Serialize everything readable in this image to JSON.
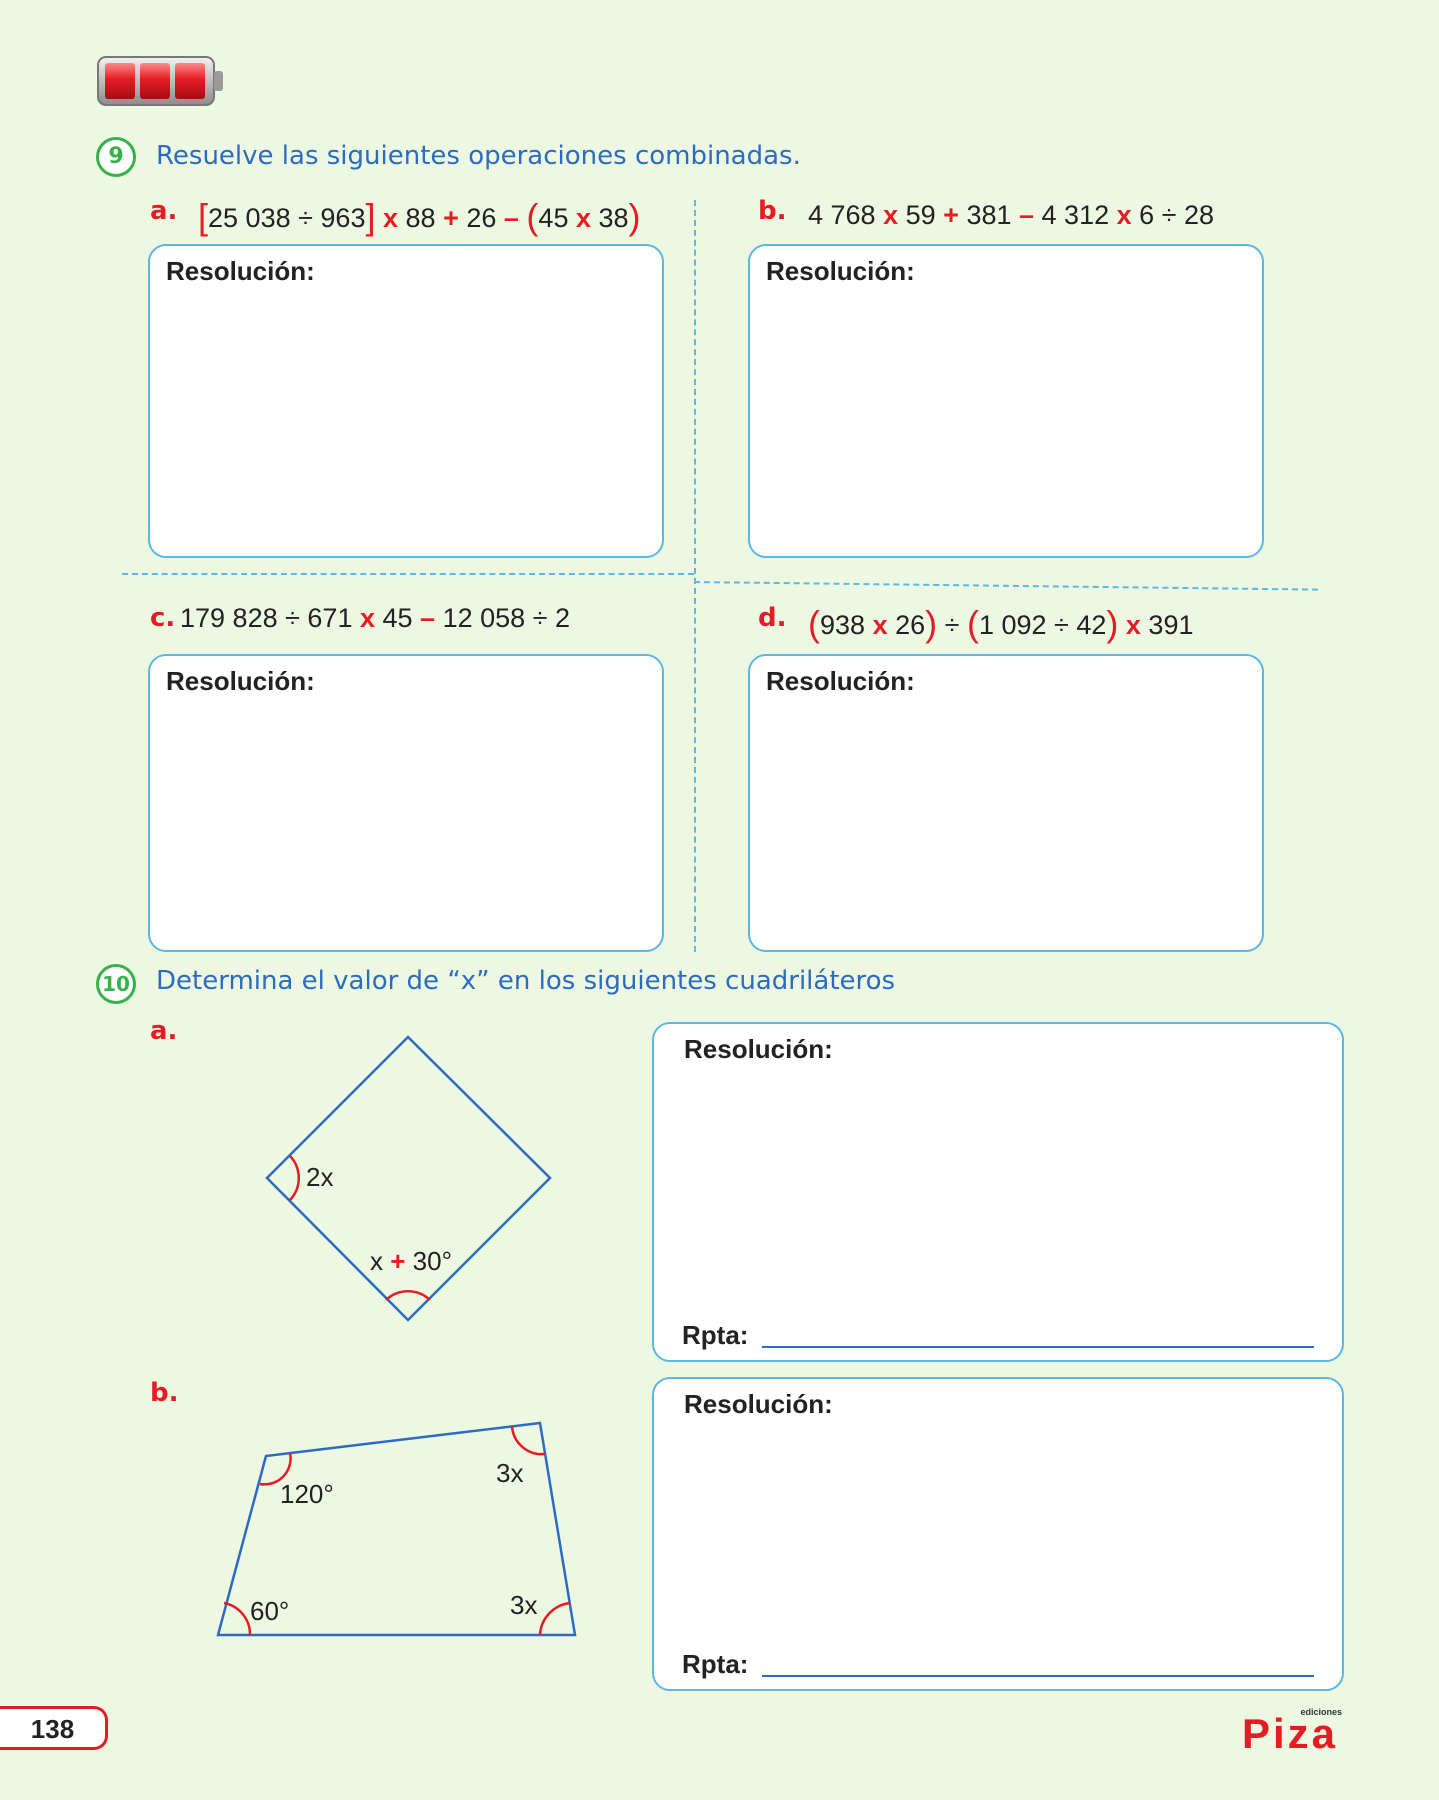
{
  "exercise9": {
    "number": "9",
    "title": "Resuelve las siguientes operaciones combinadas.",
    "items": [
      {
        "letter": "a.",
        "parts": [
          "[",
          "25 038 ÷ 963",
          "]",
          " x ",
          "88",
          " + ",
          "26",
          " – ",
          "(",
          "45",
          " x ",
          "38",
          ")"
        ],
        "label": "Resolución:"
      },
      {
        "letter": "b.",
        "parts": [
          "4 768",
          " x ",
          "59",
          " + ",
          "381",
          " – ",
          "4 312",
          " x ",
          "6 ÷ 28"
        ],
        "label": "Resolución:"
      },
      {
        "letter": "c.",
        "parts": [
          "179 828 ÷ 671",
          " x ",
          "45",
          " – ",
          "12 058 ÷ 2"
        ],
        "label": "Resolución:"
      },
      {
        "letter": "d.",
        "parts": [
          "(",
          "938",
          " x ",
          "26",
          ")",
          " ÷ ",
          "(",
          "1 092 ÷ 42",
          ")",
          " x ",
          "391"
        ],
        "label": "Resolución:"
      }
    ]
  },
  "exercise10": {
    "number": "10",
    "title": "Determina el valor de “x” en los siguientes cuadriláteros",
    "items": [
      {
        "letter": "a.",
        "label": "Resolución:",
        "answer_label": "Rpta:",
        "angles": {
          "left": "2x",
          "bottom_x": "x",
          "bottom_op": "+",
          "bottom_val": "30°"
        }
      },
      {
        "letter": "b.",
        "label": "Resolución:",
        "answer_label": "Rpta:",
        "angles": {
          "top_left": "120°",
          "top_right": "3x",
          "bottom_left": "60°",
          "bottom_right": "3x"
        }
      }
    ]
  },
  "footer": {
    "page_number": "138",
    "brand_small": "ediciones",
    "brand": "Piza"
  },
  "colors": {
    "accent_red": "#e51c24",
    "accent_blue": "#2c6cc0",
    "box_border": "#5bb7e8",
    "green": "#35b24a",
    "background": "#edf8e2"
  },
  "icons": [
    "battery-icon"
  ]
}
